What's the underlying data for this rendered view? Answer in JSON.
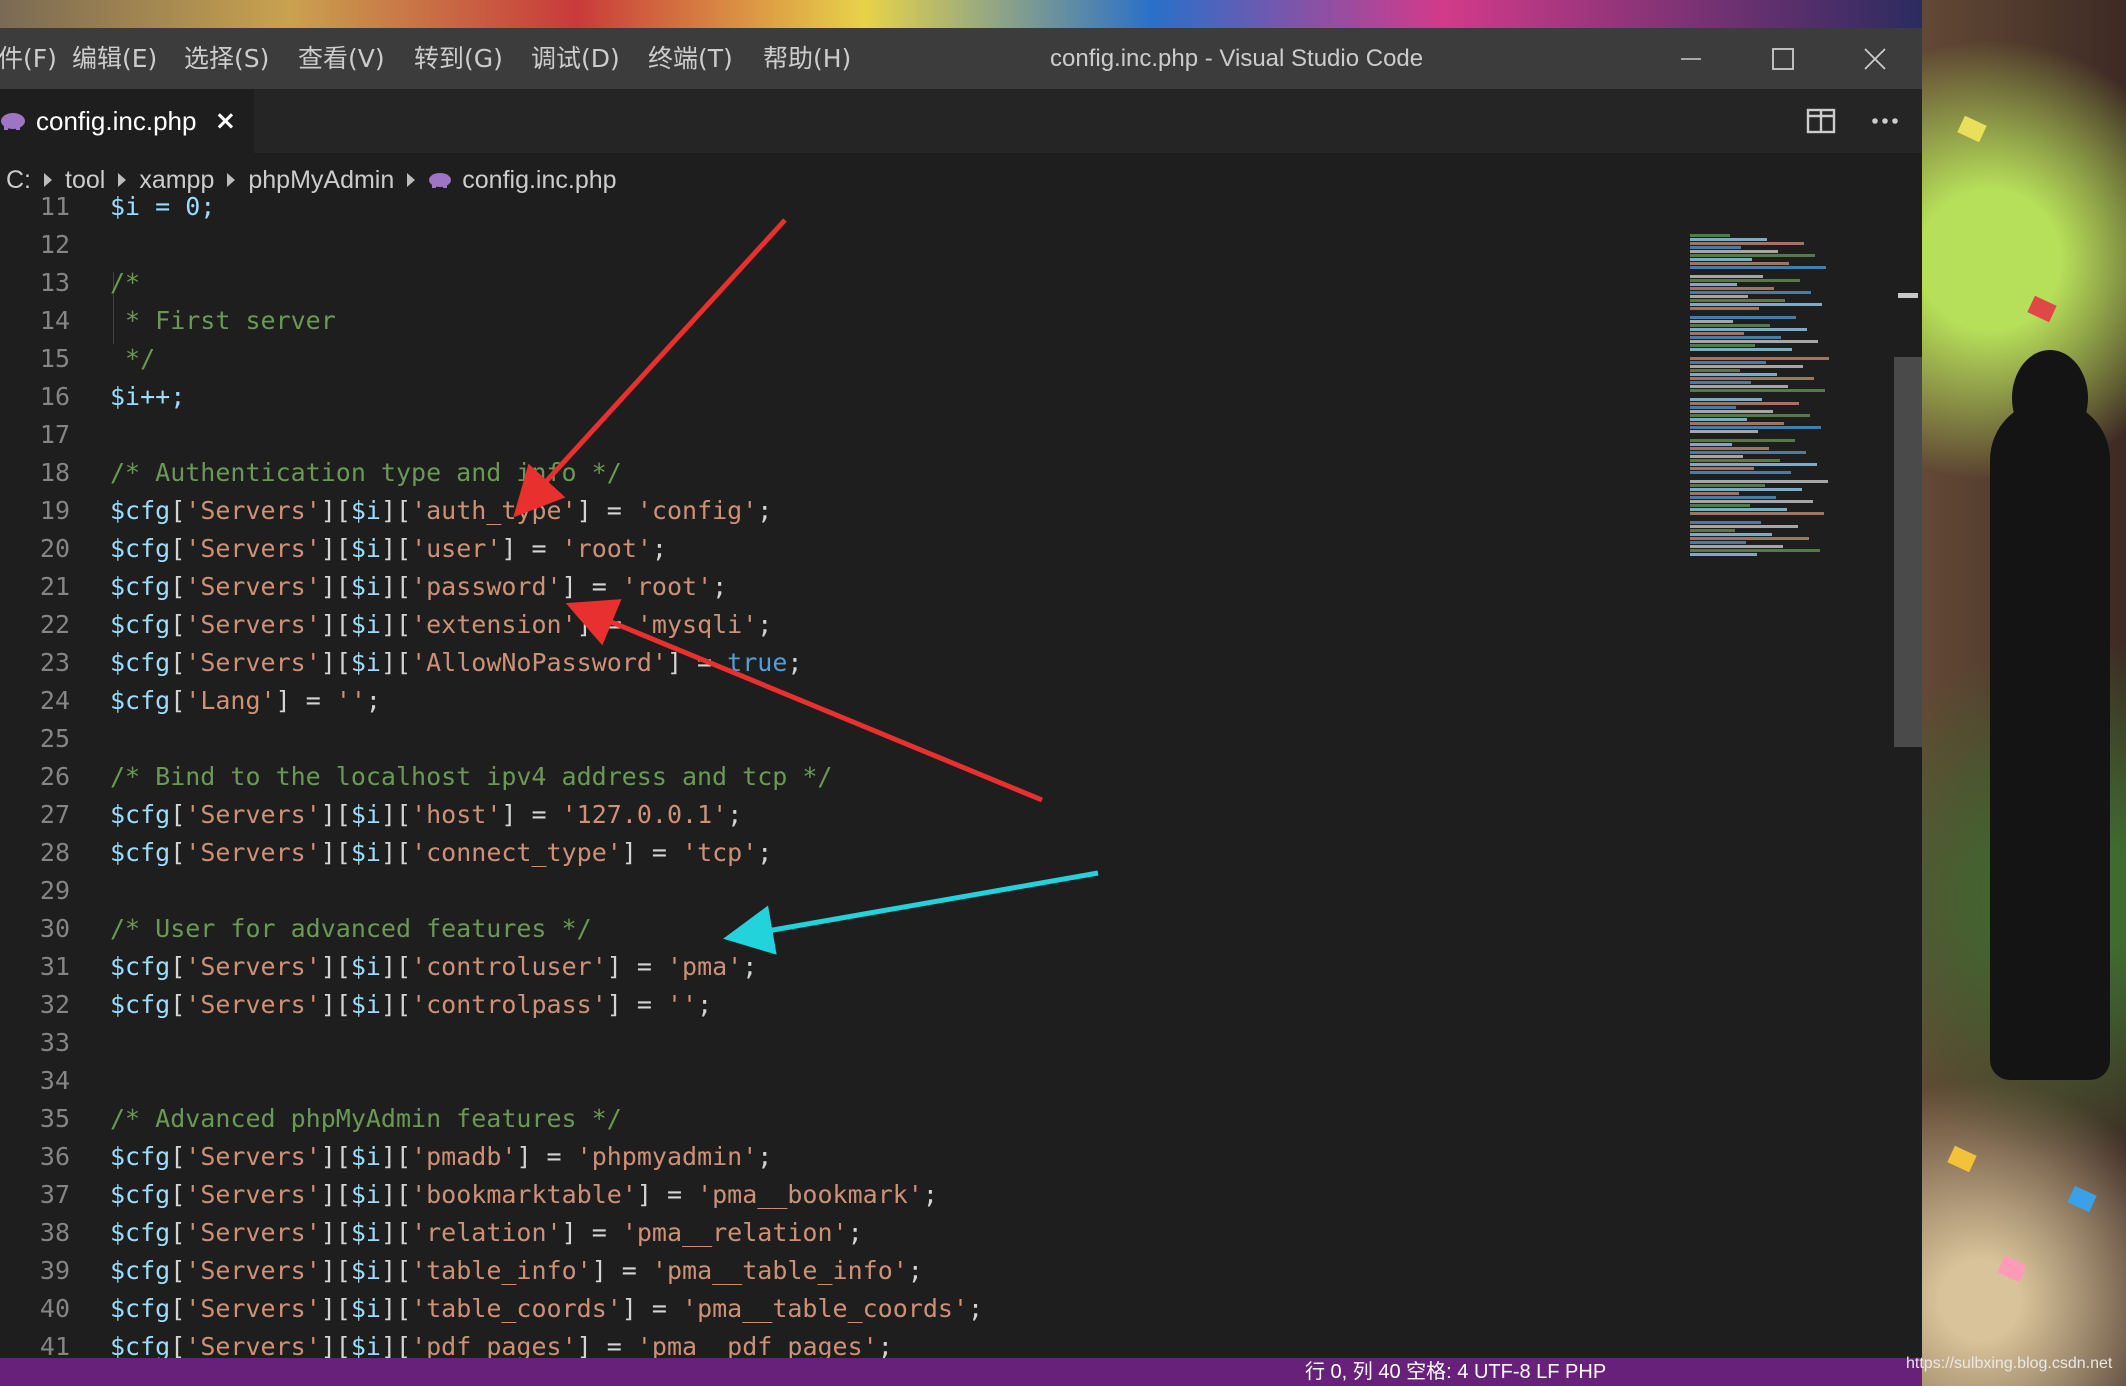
{
  "app": {
    "window_title": "config.inc.php - Visual Studio Code"
  },
  "menu": [
    {
      "label": "件(F)"
    },
    {
      "label": "编辑(E)"
    },
    {
      "label": "选择(S)"
    },
    {
      "label": "查看(V)"
    },
    {
      "label": "转到(G)"
    },
    {
      "label": "调试(D)"
    },
    {
      "label": "终端(T)"
    },
    {
      "label": "帮助(H)"
    }
  ],
  "tab": {
    "label": "config.inc.php",
    "close_glyph": "×"
  },
  "breadcrumb": {
    "items": [
      "C:",
      "tool",
      "xampp",
      "phpMyAdmin",
      "config.inc.php"
    ]
  },
  "editor": {
    "partial_top_line": {
      "number": "11",
      "text": "$i = 0;"
    },
    "lines": [
      {
        "number": "12",
        "kind": "blank",
        "text": ""
      },
      {
        "number": "13",
        "kind": "comment",
        "text": "/*"
      },
      {
        "number": "14",
        "kind": "comment",
        "text": " * First server"
      },
      {
        "number": "15",
        "kind": "comment",
        "text": " */"
      },
      {
        "number": "16",
        "kind": "var",
        "text": "$i++;"
      },
      {
        "number": "17",
        "kind": "blank",
        "text": ""
      },
      {
        "number": "18",
        "kind": "comment",
        "text": "/* Authentication type and info */"
      },
      {
        "number": "19",
        "kind": "cfg",
        "key": "auth_type",
        "value": "'config'"
      },
      {
        "number": "20",
        "kind": "cfg",
        "key": "user",
        "value": "'root'"
      },
      {
        "number": "21",
        "kind": "cfg",
        "key": "password",
        "value": "'root'"
      },
      {
        "number": "22",
        "kind": "cfg",
        "key": "extension",
        "value": "'mysqli'"
      },
      {
        "number": "23",
        "kind": "cfg",
        "key": "AllowNoPassword",
        "value": "true"
      },
      {
        "number": "24",
        "kind": "lang",
        "text": "$cfg['Lang'] = '';"
      },
      {
        "number": "25",
        "kind": "blank",
        "text": ""
      },
      {
        "number": "26",
        "kind": "comment",
        "text": "/* Bind to the localhost ipv4 address and tcp */"
      },
      {
        "number": "27",
        "kind": "cfg",
        "key": "host",
        "value": "'127.0.0.1'"
      },
      {
        "number": "28",
        "kind": "cfg",
        "key": "connect_type",
        "value": "'tcp'"
      },
      {
        "number": "29",
        "kind": "blank",
        "text": ""
      },
      {
        "number": "30",
        "kind": "comment",
        "text": "/* User for advanced features */"
      },
      {
        "number": "31",
        "kind": "cfg",
        "key": "controluser",
        "value": "'pma'"
      },
      {
        "number": "32",
        "kind": "cfg",
        "key": "controlpass",
        "value": "''"
      },
      {
        "number": "33",
        "kind": "blank",
        "text": ""
      },
      {
        "number": "34",
        "kind": "blank",
        "text": ""
      },
      {
        "number": "35",
        "kind": "comment",
        "text": "/* Advanced phpMyAdmin features */"
      },
      {
        "number": "36",
        "kind": "cfg",
        "key": "pmadb",
        "value": "'phpmyadmin'"
      },
      {
        "number": "37",
        "kind": "cfg",
        "key": "bookmarktable",
        "value": "'pma__bookmark'"
      },
      {
        "number": "38",
        "kind": "cfg",
        "key": "relation",
        "value": "'pma__relation'"
      },
      {
        "number": "39",
        "kind": "cfg",
        "key": "table_info",
        "value": "'pma__table_info'"
      },
      {
        "number": "40",
        "kind": "cfg",
        "key": "table_coords",
        "value": "'pma__table_coords'"
      },
      {
        "number": "41",
        "kind": "cfg",
        "key": "pdf_pages",
        "value": "'pma__pdf_pages'"
      }
    ]
  },
  "statusbar": {
    "text": "行 0,  列 40    空格: 4    UTF-8    LF    PHP"
  },
  "watermark": "https://sulbxing.blog.csdn.net",
  "colors": {
    "editor_bg": "#1e1e1e",
    "titlebar_bg": "#3c3c3c",
    "statusbar_bg": "#68217a",
    "comment": "#6a9955",
    "string": "#ce9178",
    "variable": "#9cdcfe",
    "keyword": "#569cd6",
    "arrow_red": "#e8302f",
    "arrow_cyan": "#22d3dc"
  },
  "icons": {
    "file_icon": "php-elephant-icon",
    "split_editor": "split-editor-icon",
    "more_actions": "more-actions-icon",
    "minimize": "minimize-icon",
    "maximize": "maximize-icon",
    "close": "close-icon"
  }
}
